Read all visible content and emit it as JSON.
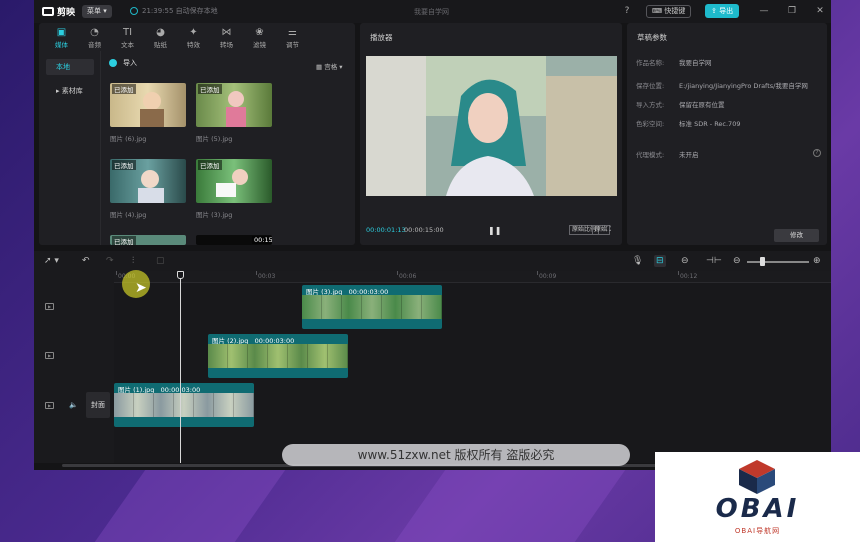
{
  "app": {
    "name": "剪映",
    "menu_label": "菜单",
    "autosave": "21:39:55 自动保存本地",
    "project_title": "我要自学网",
    "shortcut_label": "快捷键",
    "export_label": "导出"
  },
  "media": {
    "tabs": [
      {
        "label": "媒体",
        "icon": "media-icon"
      },
      {
        "label": "音频",
        "icon": "audio-icon"
      },
      {
        "label": "文本",
        "icon": "text-icon"
      },
      {
        "label": "贴纸",
        "icon": "sticker-icon"
      },
      {
        "label": "特效",
        "icon": "effects-icon"
      },
      {
        "label": "转场",
        "icon": "transition-icon"
      },
      {
        "label": "滤镜",
        "icon": "filter-icon"
      },
      {
        "label": "调节",
        "icon": "adjust-icon"
      }
    ],
    "side": [
      "本地",
      "素材库"
    ],
    "import_label": "导入",
    "view_label": "宫格",
    "added_tag": "已添加",
    "thumbs": [
      {
        "name": "图片 (6).jpg"
      },
      {
        "name": "图片 (5).jpg"
      },
      {
        "name": "图片 (4).jpg"
      },
      {
        "name": "图片 (3).jpg"
      }
    ],
    "partial_tag": "已添加",
    "partial_duration": "00:15"
  },
  "player": {
    "title": "播放器",
    "current_time": "00:00:01:13",
    "total_time": "00:00:15:00",
    "btn_ratio": "原始比例",
    "btn_quality": "原始"
  },
  "draft": {
    "title": "草稿参数",
    "rows": [
      {
        "k": "作品名称:",
        "v": "我要自学网"
      },
      {
        "k": "保存位置:",
        "v": "E:/jianying/JianyingPro Drafts/我要自学网"
      },
      {
        "k": "导入方式:",
        "v": "保留在原有位置"
      },
      {
        "k": "色彩空间:",
        "v": "标准 SDR - Rec.709"
      },
      {
        "k": "代理模式:",
        "v": "未开启"
      }
    ],
    "edit_label": "修改"
  },
  "timeline": {
    "ticks": [
      "00:00",
      "00:03",
      "00:06",
      "00:09",
      "00:12"
    ],
    "clips": [
      {
        "label": "图片 (3).jpg",
        "duration": "00:00:03:00"
      },
      {
        "label": "图片 (2).jpg",
        "duration": "00:00:03:00"
      },
      {
        "label": "图片 (1).jpg",
        "duration": "00:00:03:00"
      }
    ],
    "cover_label": "封面"
  },
  "watermark": "www.51zxw.net 版权所有 盗版必究",
  "brand": {
    "word": "OBAI",
    "sub": "OBAI导航网"
  }
}
